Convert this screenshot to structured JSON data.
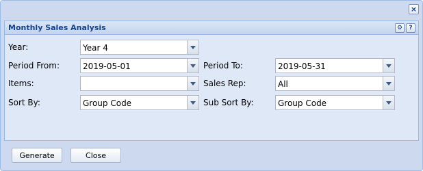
{
  "window": {
    "close_glyph": "×"
  },
  "panel": {
    "title": "Monthly Sales Analysis",
    "tools": {
      "settings_glyph": "⚙",
      "help_glyph": "?"
    }
  },
  "form": {
    "year": {
      "label": "Year:",
      "value": "Year 4"
    },
    "period_from": {
      "label": "Period From:",
      "value": "2019-05-01"
    },
    "period_to": {
      "label": "Period To:",
      "value": "2019-05-31"
    },
    "items": {
      "label": "Items:",
      "value": ""
    },
    "sales_rep": {
      "label": "Sales Rep:",
      "value": "All"
    },
    "sort_by": {
      "label": "Sort By:",
      "value": "Group Code"
    },
    "sub_sort_by": {
      "label": "Sub Sort By:",
      "value": "Group Code"
    }
  },
  "buttons": {
    "generate": "Generate",
    "close": "Close"
  },
  "icons": {
    "close": "close-icon",
    "settings": "gear-icon",
    "help": "help-icon",
    "dropdown": "chevron-down-icon"
  },
  "colors": {
    "window_bg": "#cdd9ee",
    "panel_bg": "#dfe8f6",
    "title_text": "#15428b",
    "border": "#99bbe8"
  }
}
